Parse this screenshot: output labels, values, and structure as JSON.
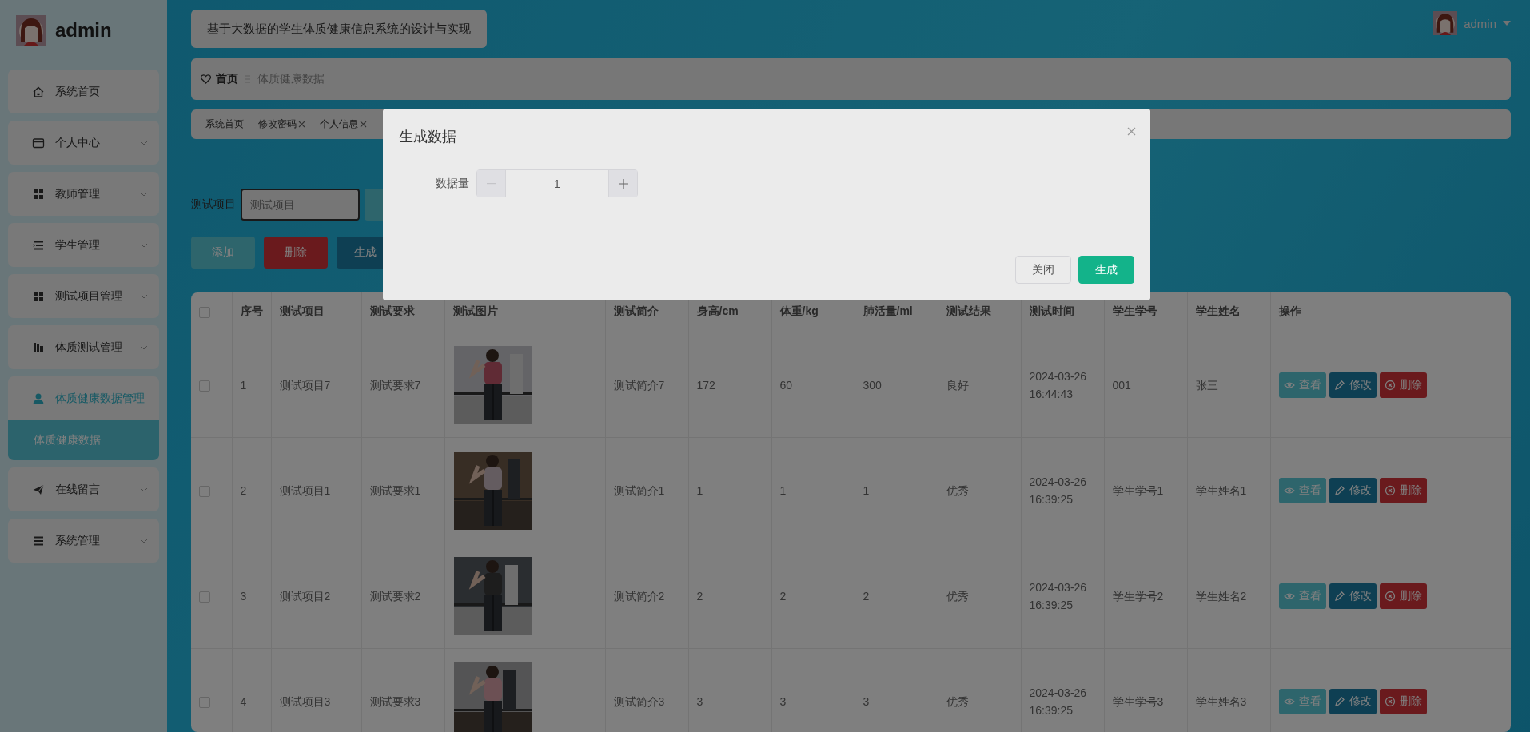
{
  "sidebar": {
    "user": "admin",
    "items": [
      {
        "label": "系统首页",
        "chevron": false,
        "selected": false
      },
      {
        "label": "个人中心",
        "chevron": true,
        "selected": false,
        "expanded": false
      },
      {
        "label": "教师管理",
        "chevron": true,
        "selected": false,
        "expanded": false
      },
      {
        "label": "学生管理",
        "chevron": true,
        "selected": false,
        "expanded": false
      },
      {
        "label": "测试项目管理",
        "chevron": true,
        "selected": false,
        "expanded": false
      },
      {
        "label": "体质测试管理",
        "chevron": true,
        "selected": false,
        "expanded": false
      },
      {
        "label": "体质健康数据管理",
        "chevron": false,
        "selected": true,
        "expanded": true,
        "children": [
          {
            "label": "体质健康数据",
            "selected": true
          }
        ]
      },
      {
        "label": "在线留言",
        "chevron": true,
        "selected": false,
        "expanded": false
      },
      {
        "label": "系统管理",
        "chevron": true,
        "selected": false,
        "expanded": false
      }
    ]
  },
  "header": {
    "title": "基于大数据的学生体质健康信息系统的设计与实现",
    "user": "admin"
  },
  "breadcrumb": [
    "首页",
    "体质健康数据"
  ],
  "tags": [
    {
      "label": "系统首页",
      "closable": false
    },
    {
      "label": "修改密码",
      "closable": true
    },
    {
      "label": "个人信息",
      "closable": true
    }
  ],
  "search": {
    "label": "测试项目",
    "placeholder": "测试项目"
  },
  "actions": [
    {
      "label": "添加",
      "kind": "add"
    },
    {
      "label": "删除",
      "kind": "delete"
    },
    {
      "label": "生成",
      "kind": "generate"
    }
  ],
  "table": {
    "header_checked": false,
    "columns": [
      "序号",
      "测试项目",
      "测试要求",
      "测试图片",
      "测试简介",
      "身高/cm",
      "体重/kg",
      "肺活量/ml",
      "测试结果",
      "测试时间",
      "学生学号",
      "学生姓名",
      "操作"
    ],
    "rows": [
      {
        "checked": false,
        "cells": [
          "1",
          "测试项目7",
          "测试要求7",
          "",
          "测试简介7",
          "172",
          "60",
          "300",
          "良好",
          "2024-03-26 16:44:43",
          "001",
          "张三"
        ],
        "actions": [
          "查看",
          "修改",
          "删除"
        ]
      },
      {
        "checked": false,
        "cells": [
          "2",
          "测试项目1",
          "测试要求1",
          "",
          "测试简介1",
          "1",
          "1",
          "1",
          "优秀",
          "2024-03-26 16:39:25",
          "学生学号1",
          "学生姓名1"
        ],
        "actions": [
          "查看",
          "修改",
          "删除"
        ]
      },
      {
        "checked": false,
        "cells": [
          "3",
          "测试项目2",
          "测试要求2",
          "",
          "测试简介2",
          "2",
          "2",
          "2",
          "优秀",
          "2024-03-26 16:39:25",
          "学生学号2",
          "学生姓名2"
        ],
        "actions": [
          "查看",
          "修改",
          "删除"
        ]
      },
      {
        "checked": false,
        "cells": [
          "4",
          "测试项目3",
          "测试要求3",
          "",
          "测试简介3",
          "3",
          "3",
          "3",
          "优秀",
          "2024-03-26 16:39:25",
          "学生学号3",
          "学生姓名3"
        ],
        "actions": [
          "查看",
          "修改",
          "删除"
        ]
      }
    ]
  },
  "modal": {
    "title": "生成数据",
    "field_label": "数据量",
    "value": "1",
    "decrease_disabled": true,
    "buttons": [
      {
        "label": "关闭",
        "kind": "default"
      },
      {
        "label": "生成",
        "kind": "primary"
      }
    ]
  }
}
